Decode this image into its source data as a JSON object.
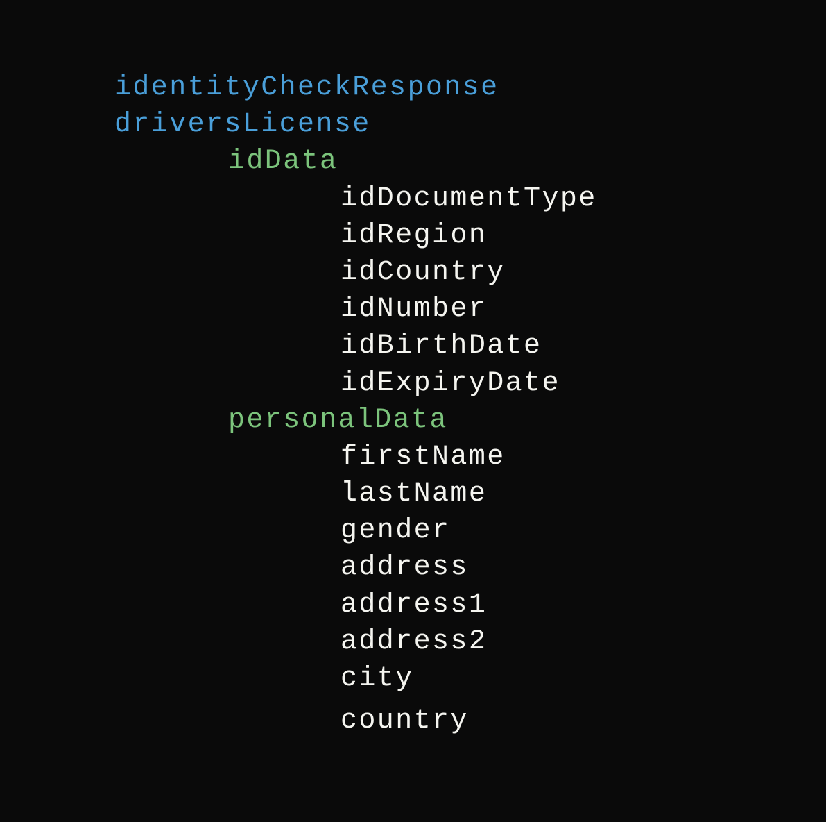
{
  "tree": {
    "root1": "identityCheckResponse",
    "root2": "driversLicense",
    "section1": "idData",
    "section1_items": {
      "item0": "idDocumentType",
      "item1": "idRegion",
      "item2": "idCountry",
      "item3": "idNumber",
      "item4": "idBirthDate",
      "item5": "idExpiryDate"
    },
    "section2": "personalData",
    "section2_items": {
      "item0": "firstName",
      "item1": "lastName",
      "item2": "gender",
      "item3": "address",
      "item4": "address1",
      "item5": "address2",
      "item6": "city",
      "item7": "country"
    }
  },
  "colors": {
    "background": "#0a0a0a",
    "level0": "#4a9fd9",
    "level1": "#7cc47c",
    "level2": "#f5f5f0"
  }
}
